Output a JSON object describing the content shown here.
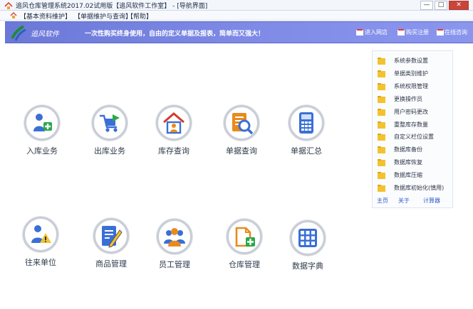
{
  "window": {
    "title": "追风仓库管理系统2017.02试用版【追风软件工作室】 - [导航界面]",
    "controls": [
      "—",
      "□",
      "✕"
    ]
  },
  "menu": {
    "items": [
      "【基本资料维护】",
      "【单据维护与查询】",
      "【帮助】"
    ]
  },
  "banner": {
    "logo_text": "追风软件",
    "slogan": "一次性购买终身使用，自由的定义单据及报表，简单而又强大！",
    "links": [
      "进入网店",
      "购买注册",
      "在线咨询"
    ]
  },
  "tiles": {
    "row1": [
      "入库业务",
      "出库业务",
      "库存查询",
      "单据查询",
      "单据汇总"
    ],
    "row2": [
      "往来单位",
      "商品管理",
      "员工管理",
      "仓库管理",
      "数据字典"
    ]
  },
  "right_panel": {
    "items": [
      "系统参数设置",
      "单据类别维护",
      "系统权限管理",
      "更换操作员",
      "用户密码更改",
      "重整库存数量",
      "自定义栏位设置",
      "数据库备份",
      "数据库恢复",
      "数据库压缩",
      "数据库初始化(慎用)"
    ],
    "footer": [
      "主页",
      "关于",
      "计算器"
    ]
  },
  "colors": {
    "banner": "#7f8be6",
    "accent_green": "#2aa84a",
    "accent_blue": "#3a6fd6",
    "accent_orange": "#e88b1c",
    "accent_red": "#d23b2e"
  }
}
